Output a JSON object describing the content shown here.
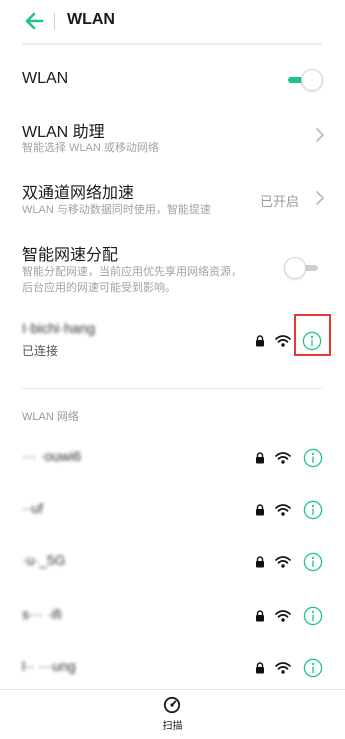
{
  "header": {
    "title": "WLAN"
  },
  "settings": {
    "wlan": {
      "label": "WLAN",
      "enabled": true
    },
    "assistant": {
      "label": "WLAN 助理",
      "subtitle": "智能选择 WLAN 或移动网络"
    },
    "dual_channel": {
      "label": "双通道网络加速",
      "subtitle": "WLAN 与移动数据同时使用，智能提速",
      "status": "已开启"
    },
    "speed_allocation": {
      "label": "智能网速分配",
      "subtitle_line1": "智能分配网速，当前应用优先享用网络资源，",
      "subtitle_line2": "后台应用的网速可能受到影响。",
      "enabled": false
    }
  },
  "connected": {
    "name": "I·bichi·hang",
    "status": "已连接"
  },
  "networks_section": {
    "title": "WLAN 网络"
  },
  "networks": [
    {
      "name": "··· ·ouwi6"
    },
    {
      "name": "··uf"
    },
    {
      "name": "·u·_5G"
    },
    {
      "name": "s··· ·ifi"
    },
    {
      "name": "l·· ···ung"
    }
  ],
  "bottom_bar": {
    "scan_label": "扫描",
    "scan_icon": "scan-gauge-icon"
  },
  "colors": {
    "accent": "#1fc382",
    "highlight": "#e53935"
  }
}
